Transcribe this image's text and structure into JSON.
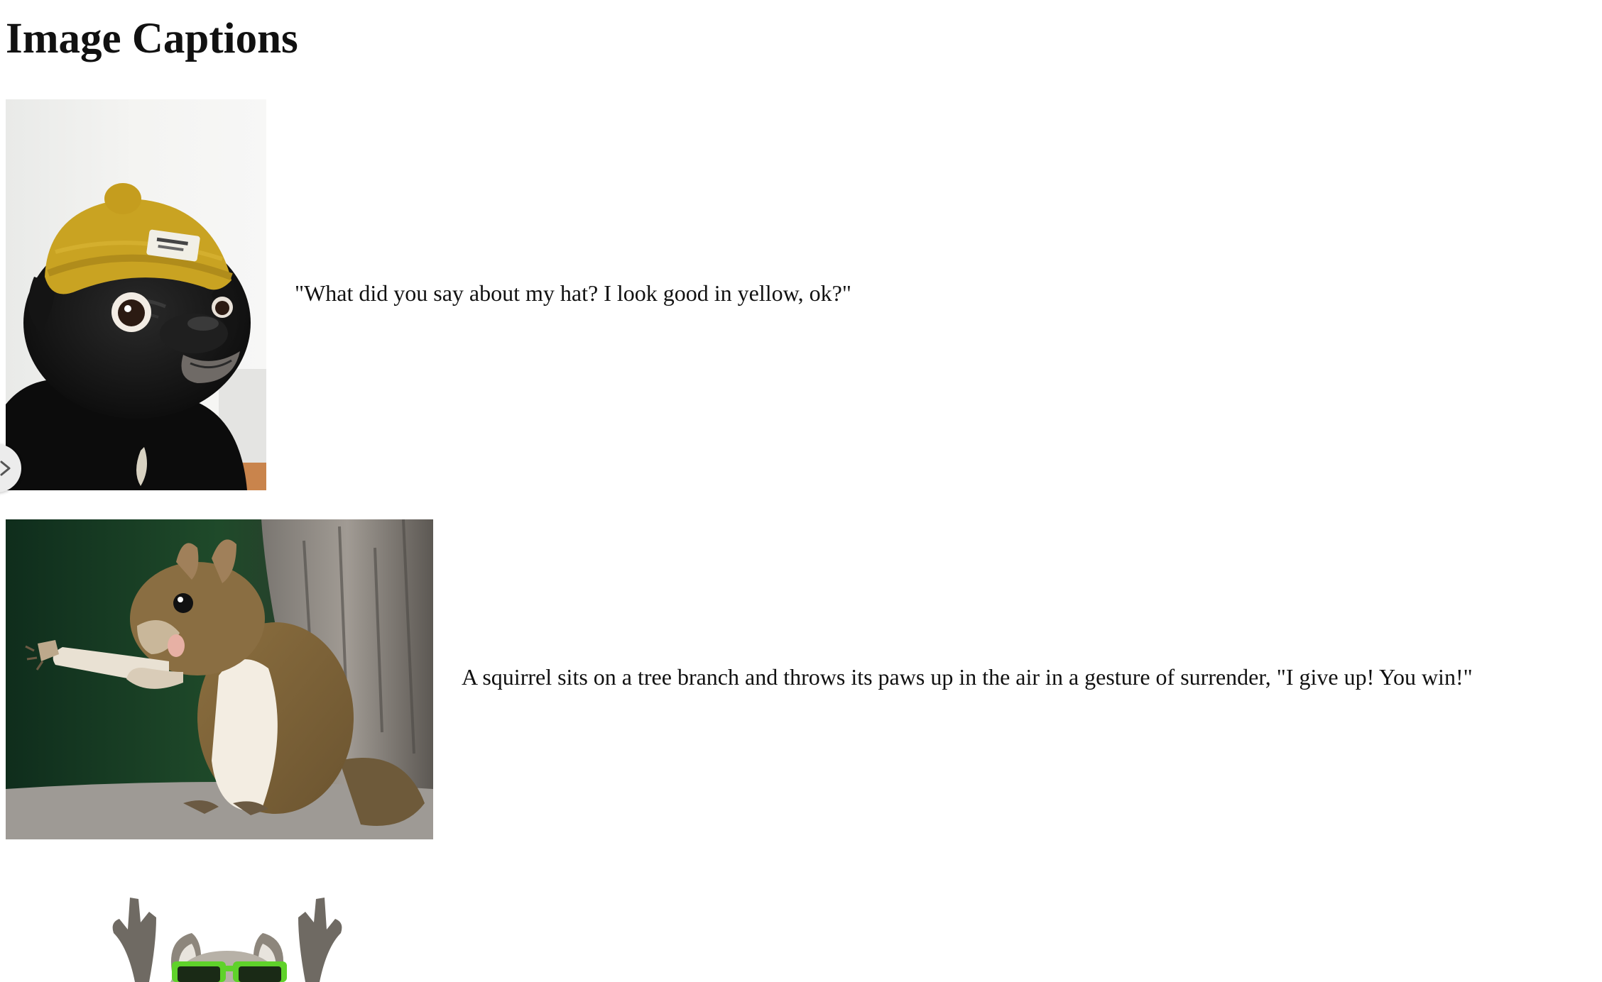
{
  "page": {
    "title": "Image Captions"
  },
  "items": [
    {
      "image": "pug-in-yellow-beanie-photo",
      "caption": "\"What did you say about my hat? I look good in yellow, ok?\""
    },
    {
      "image": "squirrel-with-raised-paws-photo",
      "caption": "A squirrel sits on a tree branch and throws its paws up in the air in a gesture of surrender, \"I give up! You win!\""
    },
    {
      "image": "raccoon-in-green-sunglasses-photo",
      "caption": ""
    }
  ],
  "ui": {
    "side_toggle_icon": "chevron-right-icon"
  },
  "colors": {
    "background": "#ffffff",
    "text": "#111111",
    "hat_yellow": "#c9a322",
    "sunglasses_green": "#5fd22a"
  }
}
